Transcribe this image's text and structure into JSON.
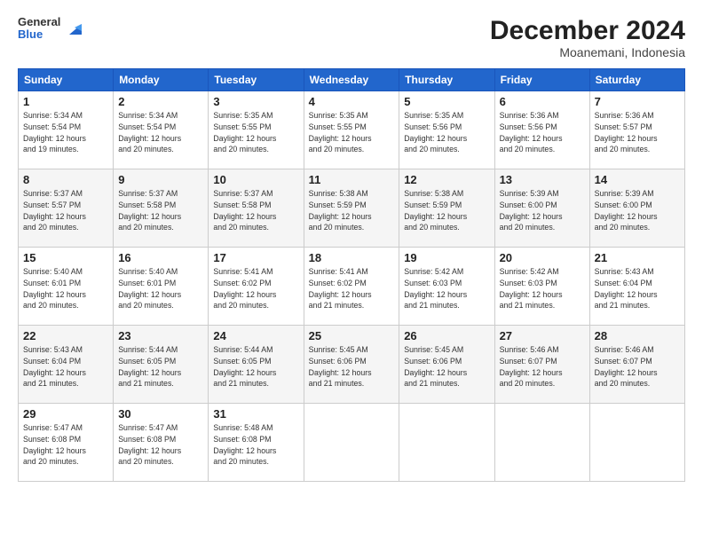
{
  "logo": {
    "line1": "General",
    "line2": "Blue"
  },
  "title": "December 2024",
  "location": "Moanemani, Indonesia",
  "days_header": [
    "Sunday",
    "Monday",
    "Tuesday",
    "Wednesday",
    "Thursday",
    "Friday",
    "Saturday"
  ],
  "weeks": [
    [
      {
        "day": "1",
        "info": "Sunrise: 5:34 AM\nSunset: 5:54 PM\nDaylight: 12 hours\nand 19 minutes."
      },
      {
        "day": "2",
        "info": "Sunrise: 5:34 AM\nSunset: 5:54 PM\nDaylight: 12 hours\nand 20 minutes."
      },
      {
        "day": "3",
        "info": "Sunrise: 5:35 AM\nSunset: 5:55 PM\nDaylight: 12 hours\nand 20 minutes."
      },
      {
        "day": "4",
        "info": "Sunrise: 5:35 AM\nSunset: 5:55 PM\nDaylight: 12 hours\nand 20 minutes."
      },
      {
        "day": "5",
        "info": "Sunrise: 5:35 AM\nSunset: 5:56 PM\nDaylight: 12 hours\nand 20 minutes."
      },
      {
        "day": "6",
        "info": "Sunrise: 5:36 AM\nSunset: 5:56 PM\nDaylight: 12 hours\nand 20 minutes."
      },
      {
        "day": "7",
        "info": "Sunrise: 5:36 AM\nSunset: 5:57 PM\nDaylight: 12 hours\nand 20 minutes."
      }
    ],
    [
      {
        "day": "8",
        "info": "Sunrise: 5:37 AM\nSunset: 5:57 PM\nDaylight: 12 hours\nand 20 minutes."
      },
      {
        "day": "9",
        "info": "Sunrise: 5:37 AM\nSunset: 5:58 PM\nDaylight: 12 hours\nand 20 minutes."
      },
      {
        "day": "10",
        "info": "Sunrise: 5:37 AM\nSunset: 5:58 PM\nDaylight: 12 hours\nand 20 minutes."
      },
      {
        "day": "11",
        "info": "Sunrise: 5:38 AM\nSunset: 5:59 PM\nDaylight: 12 hours\nand 20 minutes."
      },
      {
        "day": "12",
        "info": "Sunrise: 5:38 AM\nSunset: 5:59 PM\nDaylight: 12 hours\nand 20 minutes."
      },
      {
        "day": "13",
        "info": "Sunrise: 5:39 AM\nSunset: 6:00 PM\nDaylight: 12 hours\nand 20 minutes."
      },
      {
        "day": "14",
        "info": "Sunrise: 5:39 AM\nSunset: 6:00 PM\nDaylight: 12 hours\nand 20 minutes."
      }
    ],
    [
      {
        "day": "15",
        "info": "Sunrise: 5:40 AM\nSunset: 6:01 PM\nDaylight: 12 hours\nand 20 minutes."
      },
      {
        "day": "16",
        "info": "Sunrise: 5:40 AM\nSunset: 6:01 PM\nDaylight: 12 hours\nand 20 minutes."
      },
      {
        "day": "17",
        "info": "Sunrise: 5:41 AM\nSunset: 6:02 PM\nDaylight: 12 hours\nand 20 minutes."
      },
      {
        "day": "18",
        "info": "Sunrise: 5:41 AM\nSunset: 6:02 PM\nDaylight: 12 hours\nand 21 minutes."
      },
      {
        "day": "19",
        "info": "Sunrise: 5:42 AM\nSunset: 6:03 PM\nDaylight: 12 hours\nand 21 minutes."
      },
      {
        "day": "20",
        "info": "Sunrise: 5:42 AM\nSunset: 6:03 PM\nDaylight: 12 hours\nand 21 minutes."
      },
      {
        "day": "21",
        "info": "Sunrise: 5:43 AM\nSunset: 6:04 PM\nDaylight: 12 hours\nand 21 minutes."
      }
    ],
    [
      {
        "day": "22",
        "info": "Sunrise: 5:43 AM\nSunset: 6:04 PM\nDaylight: 12 hours\nand 21 minutes."
      },
      {
        "day": "23",
        "info": "Sunrise: 5:44 AM\nSunset: 6:05 PM\nDaylight: 12 hours\nand 21 minutes."
      },
      {
        "day": "24",
        "info": "Sunrise: 5:44 AM\nSunset: 6:05 PM\nDaylight: 12 hours\nand 21 minutes."
      },
      {
        "day": "25",
        "info": "Sunrise: 5:45 AM\nSunset: 6:06 PM\nDaylight: 12 hours\nand 21 minutes."
      },
      {
        "day": "26",
        "info": "Sunrise: 5:45 AM\nSunset: 6:06 PM\nDaylight: 12 hours\nand 21 minutes."
      },
      {
        "day": "27",
        "info": "Sunrise: 5:46 AM\nSunset: 6:07 PM\nDaylight: 12 hours\nand 20 minutes."
      },
      {
        "day": "28",
        "info": "Sunrise: 5:46 AM\nSunset: 6:07 PM\nDaylight: 12 hours\nand 20 minutes."
      }
    ],
    [
      {
        "day": "29",
        "info": "Sunrise: 5:47 AM\nSunset: 6:08 PM\nDaylight: 12 hours\nand 20 minutes."
      },
      {
        "day": "30",
        "info": "Sunrise: 5:47 AM\nSunset: 6:08 PM\nDaylight: 12 hours\nand 20 minutes."
      },
      {
        "day": "31",
        "info": "Sunrise: 5:48 AM\nSunset: 6:08 PM\nDaylight: 12 hours\nand 20 minutes."
      },
      {
        "day": "",
        "info": ""
      },
      {
        "day": "",
        "info": ""
      },
      {
        "day": "",
        "info": ""
      },
      {
        "day": "",
        "info": ""
      }
    ]
  ]
}
